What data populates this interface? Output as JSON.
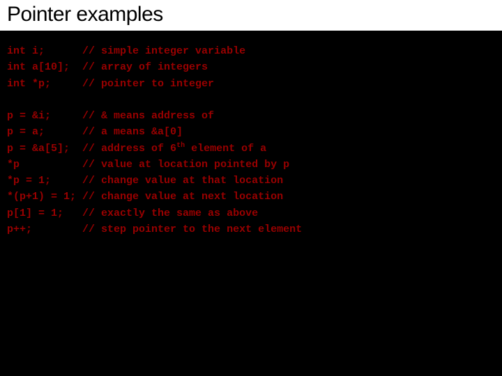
{
  "title": "Pointer examples",
  "block1": [
    {
      "code": "int i;      ",
      "comment": "// simple integer variable"
    },
    {
      "code": "int a[10];  ",
      "comment": "// array of integers"
    },
    {
      "code": "int *p;     ",
      "comment": "// pointer to integer"
    }
  ],
  "block2": [
    {
      "code": "p = &i;     ",
      "comment": "// & means address of",
      "sup": ""
    },
    {
      "code": "p = a;      ",
      "comment": "// a means &a[0]",
      "sup": ""
    },
    {
      "code": "p = &a[5];  ",
      "comment_pre": "// address of 6",
      "sup": "th",
      "comment_post": " element of a"
    },
    {
      "code": "*p          ",
      "comment": "// value at location pointed by p",
      "sup": ""
    },
    {
      "code": "*p = 1;     ",
      "comment": "// change value at that location",
      "sup": ""
    },
    {
      "code": "*(p+1) = 1; ",
      "comment": "// change value at next location",
      "sup": ""
    },
    {
      "code": "p[1] = 1;   ",
      "comment": "// exactly the same as above",
      "sup": ""
    },
    {
      "code": "p++;        ",
      "comment": "// step pointer to the next element",
      "sup": ""
    }
  ]
}
